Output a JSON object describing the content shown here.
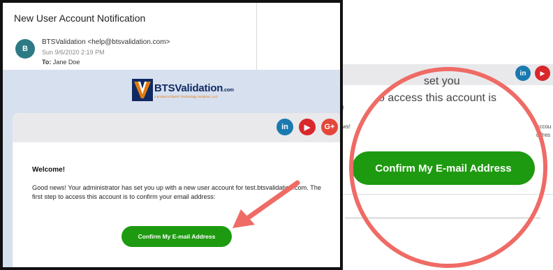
{
  "email": {
    "subject": "New User Account Notification",
    "avatar_initial": "B",
    "sender": "BTSValidation <help@btsvalidation.com>",
    "date": "Sun 9/6/2020 2:19 PM",
    "to_label": "To:",
    "to_value": "Jane Doe"
  },
  "logo": {
    "name": "BTSValidation",
    "domain": ".com",
    "tagline": "a product of Burch Technology Solutions, LLC"
  },
  "social": {
    "linkedin": "in",
    "youtube": "▶",
    "google": "G+"
  },
  "message": {
    "greeting": "Welcome!",
    "body": "Good news! Your administrator has set you up with a new user account for test.btsvalidation.com. The first step to access this account is to confirm your email address:",
    "cta_label": "Confirm My E-mail Address"
  },
  "zoom": {
    "line1": "set  you",
    "line2": "o access this account is",
    "left_fragment": "ws!",
    "right_fragment_1": "accou",
    "right_fragment_2": "ddres",
    "top_left_mark": "!",
    "cta_label": "Confirm My E-mail Address"
  },
  "colors": {
    "cta_green": "#1e9a10",
    "canvas_blue": "#d7e0ee",
    "highlight_red": "#ef6b65",
    "brand_navy": "#0f2a63",
    "brand_orange": "#e07a10"
  }
}
